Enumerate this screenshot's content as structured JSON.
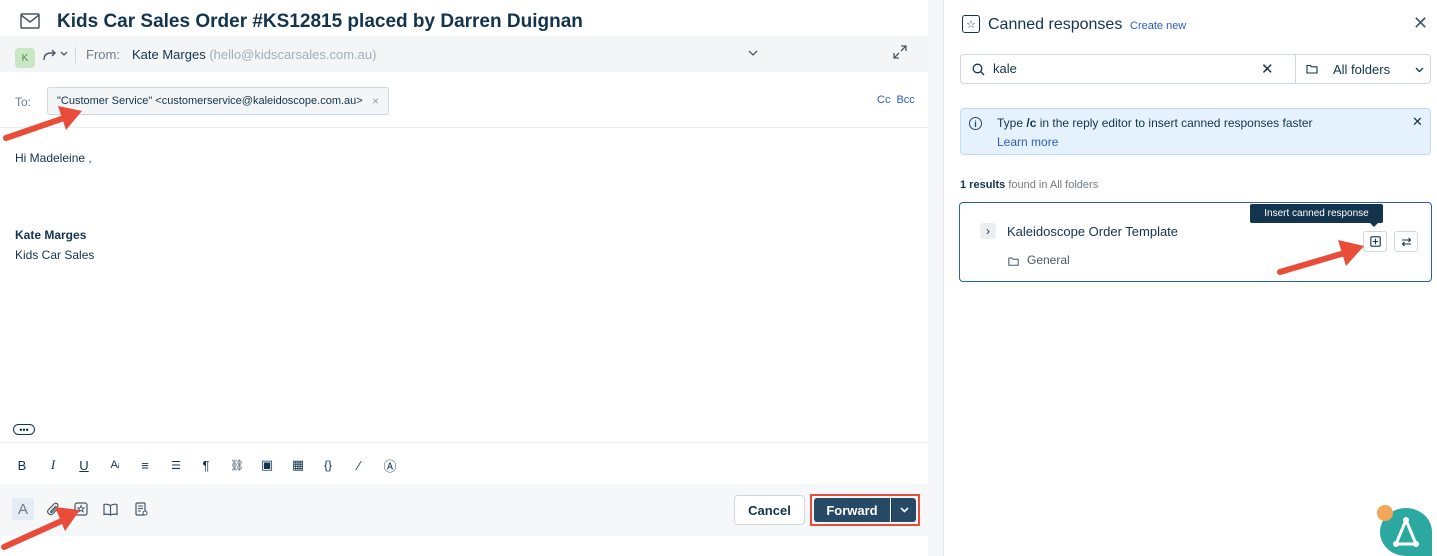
{
  "email": {
    "subject": "Kids Car Sales Order #KS12815 placed by Darren Duignan",
    "avatar_initial": "K",
    "from_label": "From:",
    "from_name": "Kate Marges",
    "from_email": "(hello@kidscarsales.com.au)",
    "to_label": "To:",
    "to_chip": "\"Customer Service\" <customerservice@kaleidoscope.com.au>",
    "to_chip_remove": "×",
    "cc_label": "Cc",
    "bcc_label": "Bcc",
    "greeting": "Hi Madeleine ,",
    "signature_name": "Kate Marges",
    "signature_company": "Kids Car Sales",
    "more_label": "•••"
  },
  "toolbar": {
    "format_items": [
      {
        "name": "bold-icon",
        "glyph": "B"
      },
      {
        "name": "italic-icon",
        "glyph": "I"
      },
      {
        "name": "underline-icon",
        "glyph": "U"
      },
      {
        "name": "font-size-icon",
        "glyph": "Aᵢ"
      },
      {
        "name": "ordered-list-icon",
        "glyph": "≡"
      },
      {
        "name": "bullet-list-icon",
        "glyph": "☰"
      },
      {
        "name": "paragraph-icon",
        "glyph": "¶"
      },
      {
        "name": "link-icon",
        "glyph": "⛓"
      },
      {
        "name": "image-icon",
        "glyph": "▣"
      },
      {
        "name": "table-icon",
        "glyph": "▦"
      },
      {
        "name": "code-icon",
        "glyph": "{}"
      },
      {
        "name": "clear-format-icon",
        "glyph": "⁄"
      },
      {
        "name": "ai-icon",
        "glyph": "Ⓐ"
      }
    ],
    "cancel_label": "Cancel",
    "forward_label": "Forward"
  },
  "canned": {
    "title": "Canned responses",
    "create_new": "Create new",
    "search_value": "kale",
    "folder_filter": "All folders",
    "info_text_before": "Type ",
    "info_text_code": "/c",
    "info_text_after": " in the reply editor to insert canned responses faster",
    "info_link": "Learn more",
    "results_count": "1 results",
    "results_suffix": "found in All folders",
    "result_name": "Kaleidoscope Order Template",
    "result_folder": "General",
    "tooltip": "Insert canned response"
  },
  "colors": {
    "primary_dark": "#264966",
    "link": "#2c5cc5",
    "highlight": "#e94d3a",
    "info_bg": "#e5f2fd"
  }
}
